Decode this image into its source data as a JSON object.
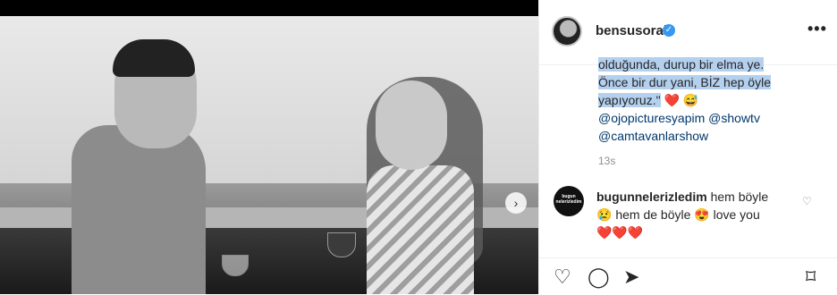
{
  "post": {
    "username": "bensusoral",
    "verified_mark": "✓",
    "more_icon": "•••",
    "next_icon": "›"
  },
  "caption": {
    "line1": "olduğunda, durup bir elma ye.",
    "line2": "Önce bir dur yani, BİZ hep öyle",
    "line3": "yapıyoruz.\"",
    "emojis": "❤️ 😅",
    "mention1": "@ojopicturesyapim",
    "mention2": "@showtv",
    "mention3": "@camtavanlarshow",
    "time": "13s"
  },
  "comment": {
    "avatar_text": "bugun nelerizledim",
    "username": "bugunnelerizledim",
    "text1": "hem böyle",
    "text2": "😢 hem de böyle 😍 love you",
    "text3": "❤️❤️❤️",
    "like_icon": "♡"
  },
  "actions": {
    "like_icon": "♡",
    "comment_icon": "◯",
    "share_icon": "➤",
    "save_icon": "⌑"
  },
  "colors": {
    "link": "#00376b",
    "verified": "#3897f0",
    "highlight": "#b4d0ef"
  }
}
